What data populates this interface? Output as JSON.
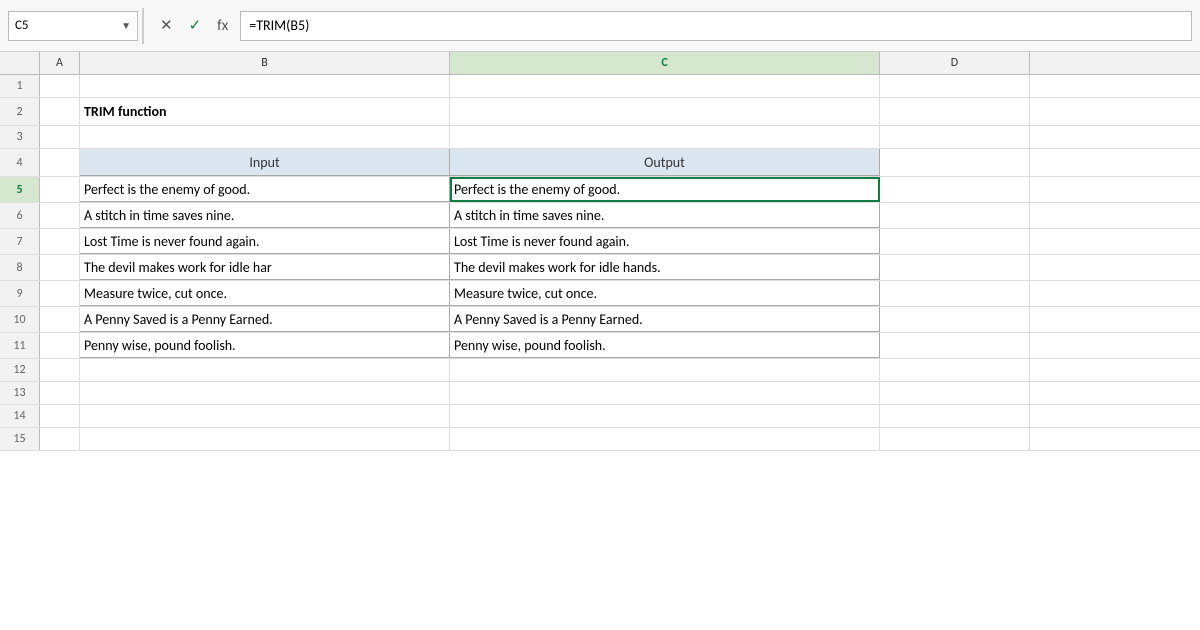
{
  "namebox": {
    "cell": "C5",
    "arrow": "▼"
  },
  "formula_bar": {
    "formula": "=TRIM(B5)",
    "icons": {
      "cancel": "✕",
      "confirm": "✓",
      "fx": "fx"
    }
  },
  "columns": {
    "headers": [
      "A",
      "B",
      "C",
      "D"
    ],
    "widths": [
      40,
      370,
      430,
      150
    ]
  },
  "rows": [
    {
      "num": 1,
      "cells": [
        "",
        "",
        "",
        ""
      ]
    },
    {
      "num": 2,
      "cells": [
        "",
        "TRIM function",
        "",
        ""
      ]
    },
    {
      "num": 3,
      "cells": [
        "",
        "",
        "",
        ""
      ]
    },
    {
      "num": 4,
      "cells": [
        "",
        "Input",
        "Output",
        ""
      ],
      "type": "header"
    },
    {
      "num": 5,
      "cells": [
        "",
        "  Perfect is    the enemy of good.",
        "Perfect is the enemy of good.",
        ""
      ],
      "type": "data",
      "selected_col": "C"
    },
    {
      "num": 6,
      "cells": [
        "",
        "A    stitch in    time    saves nine.",
        "A stitch in time saves nine.",
        ""
      ],
      "type": "data"
    },
    {
      "num": 7,
      "cells": [
        "",
        "Lost Time is never    found again.",
        "Lost Time is never found again.",
        ""
      ],
      "type": "data"
    },
    {
      "num": 8,
      "cells": [
        "",
        "   The devil    makes work for    idle har",
        "The devil makes work for idle hands.",
        ""
      ],
      "type": "data"
    },
    {
      "num": 9,
      "cells": [
        "",
        "Measure     twice,    cut once.",
        "Measure twice, cut once.",
        ""
      ],
      "type": "data"
    },
    {
      "num": 10,
      "cells": [
        "",
        "A Penny    Saved is a Penny    Earned.",
        "A Penny Saved is a Penny Earned.",
        ""
      ],
      "type": "data"
    },
    {
      "num": 11,
      "cells": [
        "",
        "   Penny    wise,    pound    foolish.",
        "Penny wise, pound foolish.",
        ""
      ],
      "type": "data"
    },
    {
      "num": 12,
      "cells": [
        "",
        "",
        "",
        ""
      ]
    },
    {
      "num": 13,
      "cells": [
        "",
        "",
        "",
        ""
      ]
    },
    {
      "num": 14,
      "cells": [
        "",
        "",
        "",
        ""
      ]
    },
    {
      "num": 15,
      "cells": [
        "",
        "",
        "",
        ""
      ]
    }
  ]
}
